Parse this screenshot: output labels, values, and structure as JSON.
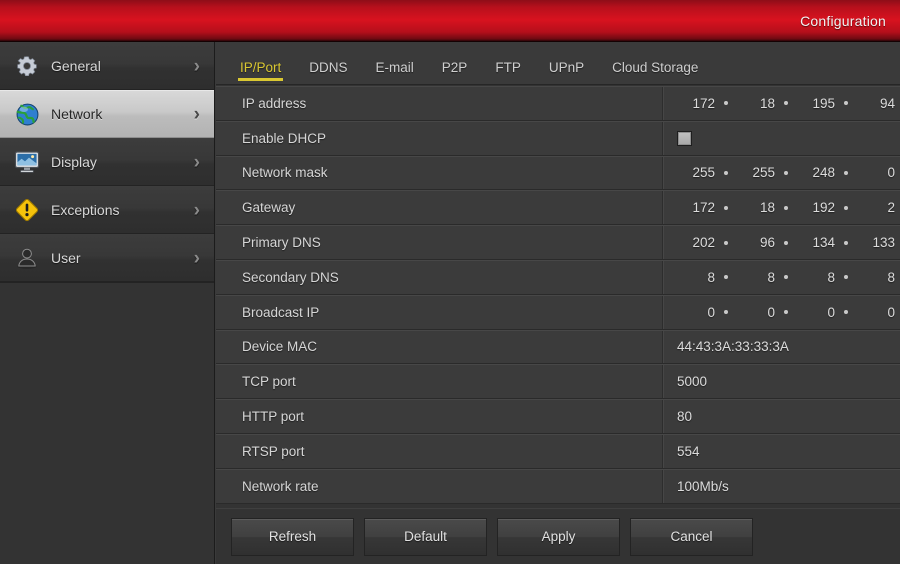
{
  "titlebar": {
    "title": "Configuration"
  },
  "sidebar": {
    "items": [
      {
        "label": "General",
        "icon": "gear-icon",
        "selected": false
      },
      {
        "label": "Network",
        "icon": "globe-icon",
        "selected": true
      },
      {
        "label": "Display",
        "icon": "monitor-icon",
        "selected": false
      },
      {
        "label": "Exceptions",
        "icon": "warning-triangle-icon",
        "selected": false
      },
      {
        "label": "User",
        "icon": "user-icon",
        "selected": false
      }
    ],
    "arrow_glyph": "›"
  },
  "tabs": {
    "items": [
      {
        "label": "IP/Port",
        "active": true
      },
      {
        "label": "DDNS",
        "active": false
      },
      {
        "label": "E-mail",
        "active": false
      },
      {
        "label": "P2P",
        "active": false
      },
      {
        "label": "FTP",
        "active": false
      },
      {
        "label": "UPnP",
        "active": false
      },
      {
        "label": "Cloud Storage",
        "active": false
      }
    ]
  },
  "form": {
    "rows": [
      {
        "label": "IP address",
        "type": "ip",
        "octets": [
          "172",
          "18",
          "195",
          "94"
        ]
      },
      {
        "label": "Enable DHCP",
        "type": "checkbox",
        "checked": false
      },
      {
        "label": "Network mask",
        "type": "ip",
        "octets": [
          "255",
          "255",
          "248",
          "0"
        ]
      },
      {
        "label": "Gateway",
        "type": "ip",
        "octets": [
          "172",
          "18",
          "192",
          "2"
        ]
      },
      {
        "label": "Primary DNS",
        "type": "ip",
        "octets": [
          "202",
          "96",
          "134",
          "133"
        ]
      },
      {
        "label": "Secondary DNS",
        "type": "ip",
        "octets": [
          "8",
          "8",
          "8",
          "8"
        ]
      },
      {
        "label": "Broadcast IP",
        "type": "ip",
        "octets": [
          "0",
          "0",
          "0",
          "0"
        ]
      },
      {
        "label": "Device MAC",
        "type": "text",
        "value": "44:43:3A:33:33:3A"
      },
      {
        "label": "TCP port",
        "type": "text",
        "value": "5000"
      },
      {
        "label": "HTTP port",
        "type": "text",
        "value": "80"
      },
      {
        "label": "RTSP port",
        "type": "text",
        "value": "554"
      },
      {
        "label": "Network rate",
        "type": "text",
        "value": "100Mb/s"
      }
    ]
  },
  "footer": {
    "buttons": [
      {
        "label": "Refresh"
      },
      {
        "label": "Default"
      },
      {
        "label": "Apply"
      },
      {
        "label": "Cancel"
      }
    ]
  },
  "colors": {
    "titlebar_red": "#d8121f",
    "accent_yellow": "#d9c732",
    "panel_bg": "#333333",
    "row_bg": "#3b3b3b",
    "warning_yellow": "#f2c40c"
  }
}
